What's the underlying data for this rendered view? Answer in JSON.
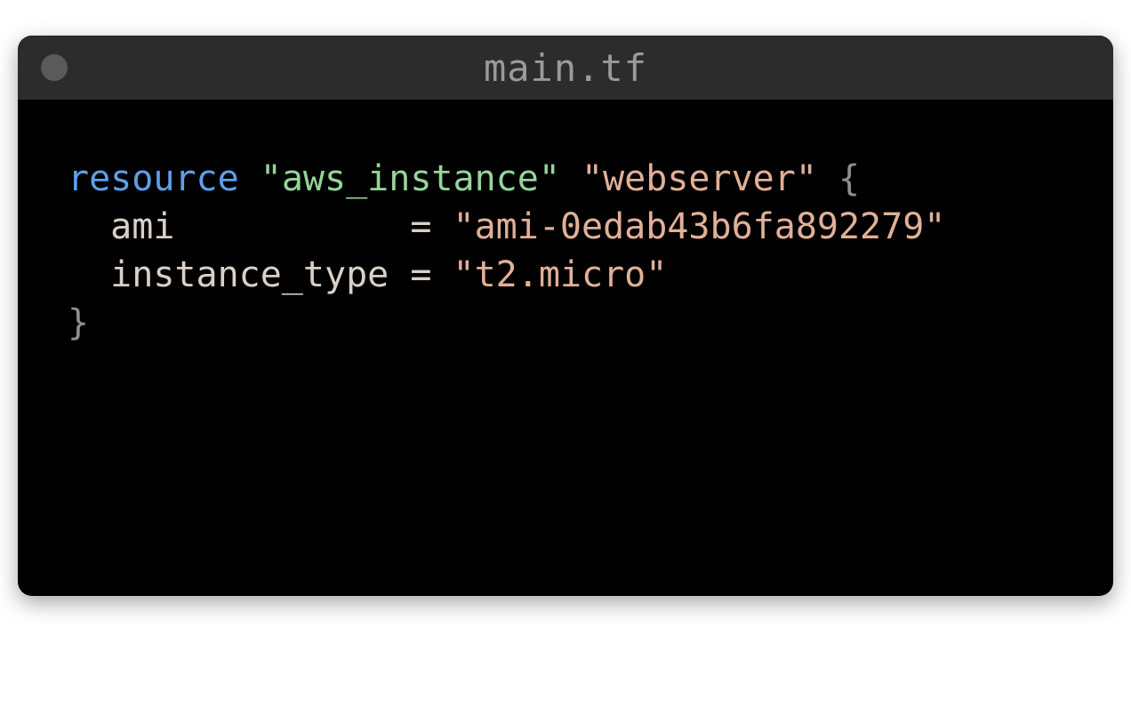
{
  "window": {
    "title": "main.tf"
  },
  "code": {
    "line1": {
      "keyword": "resource",
      "type": "\"aws_instance\"",
      "name": "\"webserver\"",
      "open": " {"
    },
    "line2": {
      "indent": "  ",
      "prop": "ami",
      "pad": "           ",
      "eq": "= ",
      "value": "\"ami-0edab43b6fa892279\""
    },
    "line3": {
      "indent": "  ",
      "prop": "instance_type",
      "pad": " ",
      "eq": "= ",
      "value": "\"t2.micro\""
    },
    "line4": {
      "close": "}"
    }
  }
}
